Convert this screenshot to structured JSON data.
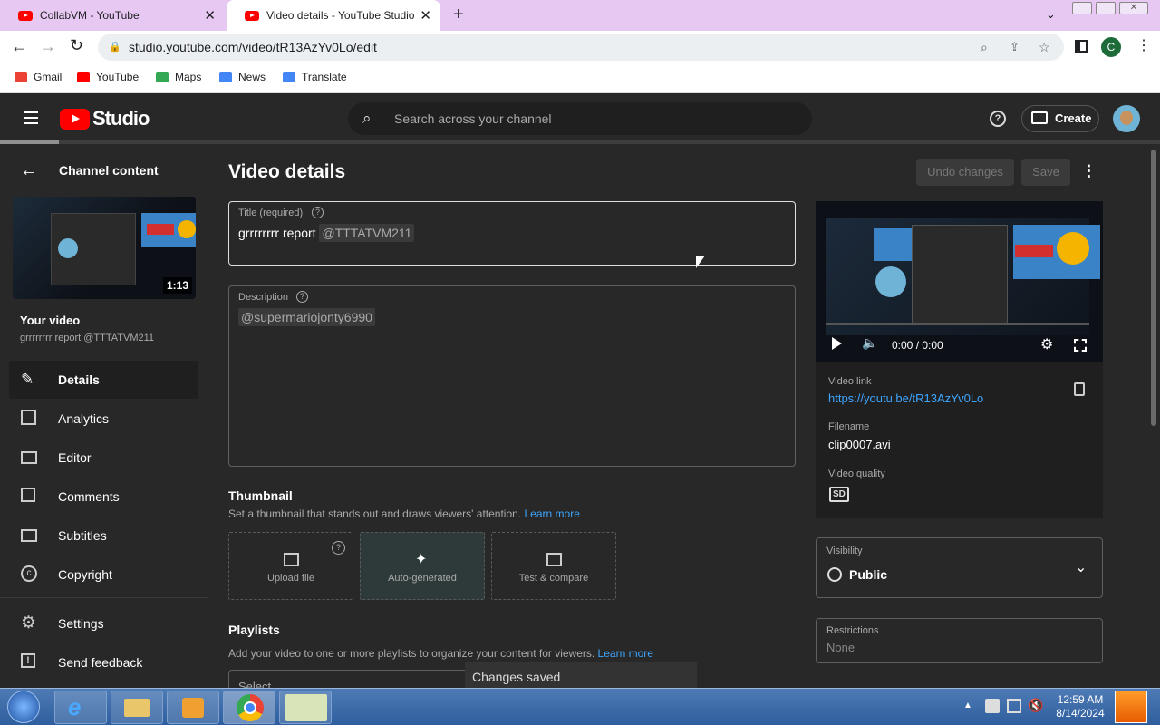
{
  "browser": {
    "tabs": [
      {
        "title": "CollabVM - YouTube"
      },
      {
        "title": "Video details - YouTube Studio"
      }
    ],
    "url": "studio.youtube.com/video/tR13AzYv0Lo/edit",
    "profile_initial": "C",
    "bookmarks": [
      {
        "label": "Gmail",
        "color": "#ea4335"
      },
      {
        "label": "YouTube",
        "color": "#ff0000"
      },
      {
        "label": "Maps",
        "color": "#34a853"
      },
      {
        "label": "News",
        "color": "#4285f4"
      },
      {
        "label": "Translate",
        "color": "#4285f4"
      }
    ]
  },
  "studio": {
    "logo_text": "Studio",
    "search_placeholder": "Search across your channel",
    "create_label": "Create"
  },
  "sidebar": {
    "back_label": "Channel content",
    "video_duration": "1:13",
    "your_video_label": "Your video",
    "video_subtitle": "grrrrrrrr report @TTTATVM211",
    "items": [
      {
        "label": "Details",
        "icon": "pencil-icon"
      },
      {
        "label": "Analytics",
        "icon": "analytics-icon"
      },
      {
        "label": "Editor",
        "icon": "film-icon"
      },
      {
        "label": "Comments",
        "icon": "comment-icon"
      },
      {
        "label": "Subtitles",
        "icon": "subtitles-icon"
      },
      {
        "label": "Copyright",
        "icon": "copyright-icon"
      },
      {
        "label": "Settings",
        "icon": "gear-icon"
      },
      {
        "label": "Send feedback",
        "icon": "feedback-icon"
      }
    ]
  },
  "main": {
    "page_title": "Video details",
    "undo_label": "Undo changes",
    "save_label": "Save",
    "title_label": "Title (required)",
    "title_text": "grrrrrrrr report",
    "title_mention": "@TTTATVM211",
    "description_label": "Description",
    "description_mention": "@supermariojonty6990",
    "thumbnail_heading": "Thumbnail",
    "thumbnail_desc": "Set a thumbnail that stands out and draws viewers' attention.",
    "learn_more": "Learn more",
    "thumb_options": [
      "Upload file",
      "Auto-generated",
      "Test & compare"
    ],
    "playlists_heading": "Playlists",
    "playlists_desc": "Add your video to one or more playlists to organize your content for viewers.",
    "playlist_select": "Select",
    "toast": "Changes saved"
  },
  "preview": {
    "time": "0:00 / 0:00",
    "video_link_label": "Video link",
    "video_link": "https://youtu.be/tR13AzYv0Lo",
    "filename_label": "Filename",
    "filename": "clip0007.avi",
    "quality_label": "Video quality",
    "quality_badge": "SD",
    "visibility_label": "Visibility",
    "visibility_value": "Public",
    "restrictions_label": "Restrictions",
    "restrictions_value": "None"
  },
  "taskbar": {
    "time": "12:59 AM",
    "date": "8/14/2024"
  },
  "colors": {
    "studio_bg": "#282828",
    "accent_link": "#3ea6ff",
    "youtube_red": "#ff0000"
  }
}
